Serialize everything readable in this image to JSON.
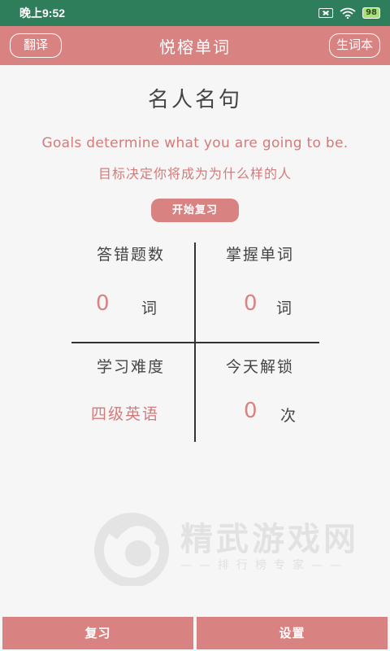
{
  "status_bar": {
    "time": "晚上9:52",
    "battery": "98"
  },
  "app_bar": {
    "title": "悦榕单词",
    "left_button": "翻译",
    "right_button": "生词本"
  },
  "main": {
    "section_title": "名人名句",
    "quote_en": "Goals determine what you are going to be.",
    "quote_cn": "目标决定你将成为为什么样的人",
    "start_review": "开始复习"
  },
  "stats": {
    "wrong_count": {
      "label": "答错题数",
      "value": "0",
      "unit": "词"
    },
    "mastered": {
      "label": "掌握单词",
      "value": "0",
      "unit": "词"
    },
    "difficulty": {
      "label": "学习难度",
      "value": "四级英语"
    },
    "unlocks_today": {
      "label": "今天解锁",
      "value": "0",
      "unit": "次"
    }
  },
  "watermark": {
    "title": "精武游戏网",
    "subtitle": "——排行榜专家——"
  },
  "bottom_bar": {
    "review": "复习",
    "settings": "设置"
  },
  "colors": {
    "accent": "#d98282",
    "status_bar": "#2e7d5b",
    "background": "#f7f6f6"
  }
}
